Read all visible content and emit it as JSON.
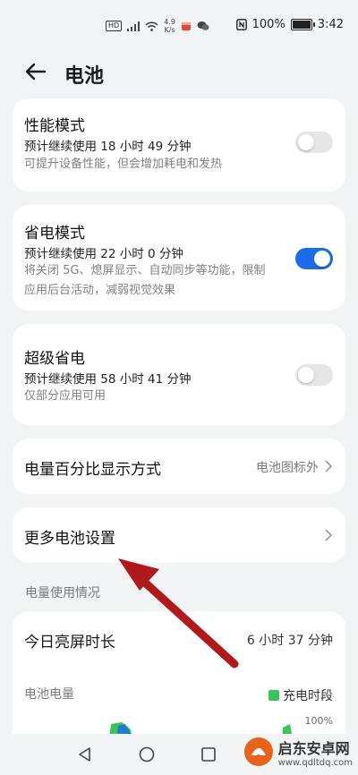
{
  "status_bar": {
    "hd_label": "HD",
    "net_speed": "4.9",
    "net_unit": "K/s",
    "nfc_label": "N",
    "battery_percent": "100%",
    "time": "3:42",
    "battery_level": 1.0
  },
  "header": {
    "title": "电池"
  },
  "performance_mode": {
    "title": "性能模式",
    "estimate": "预计继续使用 18 小时 49 分钟",
    "desc": "可提升设备性能，但会增加耗电和发热",
    "enabled": false
  },
  "power_saving": {
    "title": "省电模式",
    "estimate": "预计继续使用 22 小时 0 分钟",
    "desc": "将关闭 5G、熄屏显示、自动同步等功能，限制应用后台活动，减弱视觉效果",
    "enabled": true
  },
  "super_saving": {
    "title": "超级省电",
    "estimate": "预计继续使用 58 小时 41 分钟",
    "desc": "仅部分应用可用",
    "enabled": false
  },
  "percentage_display": {
    "label": "电量百分比显示方式",
    "value": "电池图标外"
  },
  "more_settings": {
    "label": "更多电池设置"
  },
  "usage": {
    "section_label": "电量使用情况",
    "screen_time_label": "今日亮屏时长",
    "screen_time_value": "6 小时 37 分钟",
    "battery_level_label": "电池电量",
    "legend_charging": "充电时段",
    "axis_max": "100%"
  },
  "watermark": {
    "brand": "启东安卓网",
    "url": "www.qdltdq.com"
  },
  "colors": {
    "accent": "#1a6ce8",
    "charging": "#3cc35c",
    "annotation_arrow": "#b01a1a"
  }
}
